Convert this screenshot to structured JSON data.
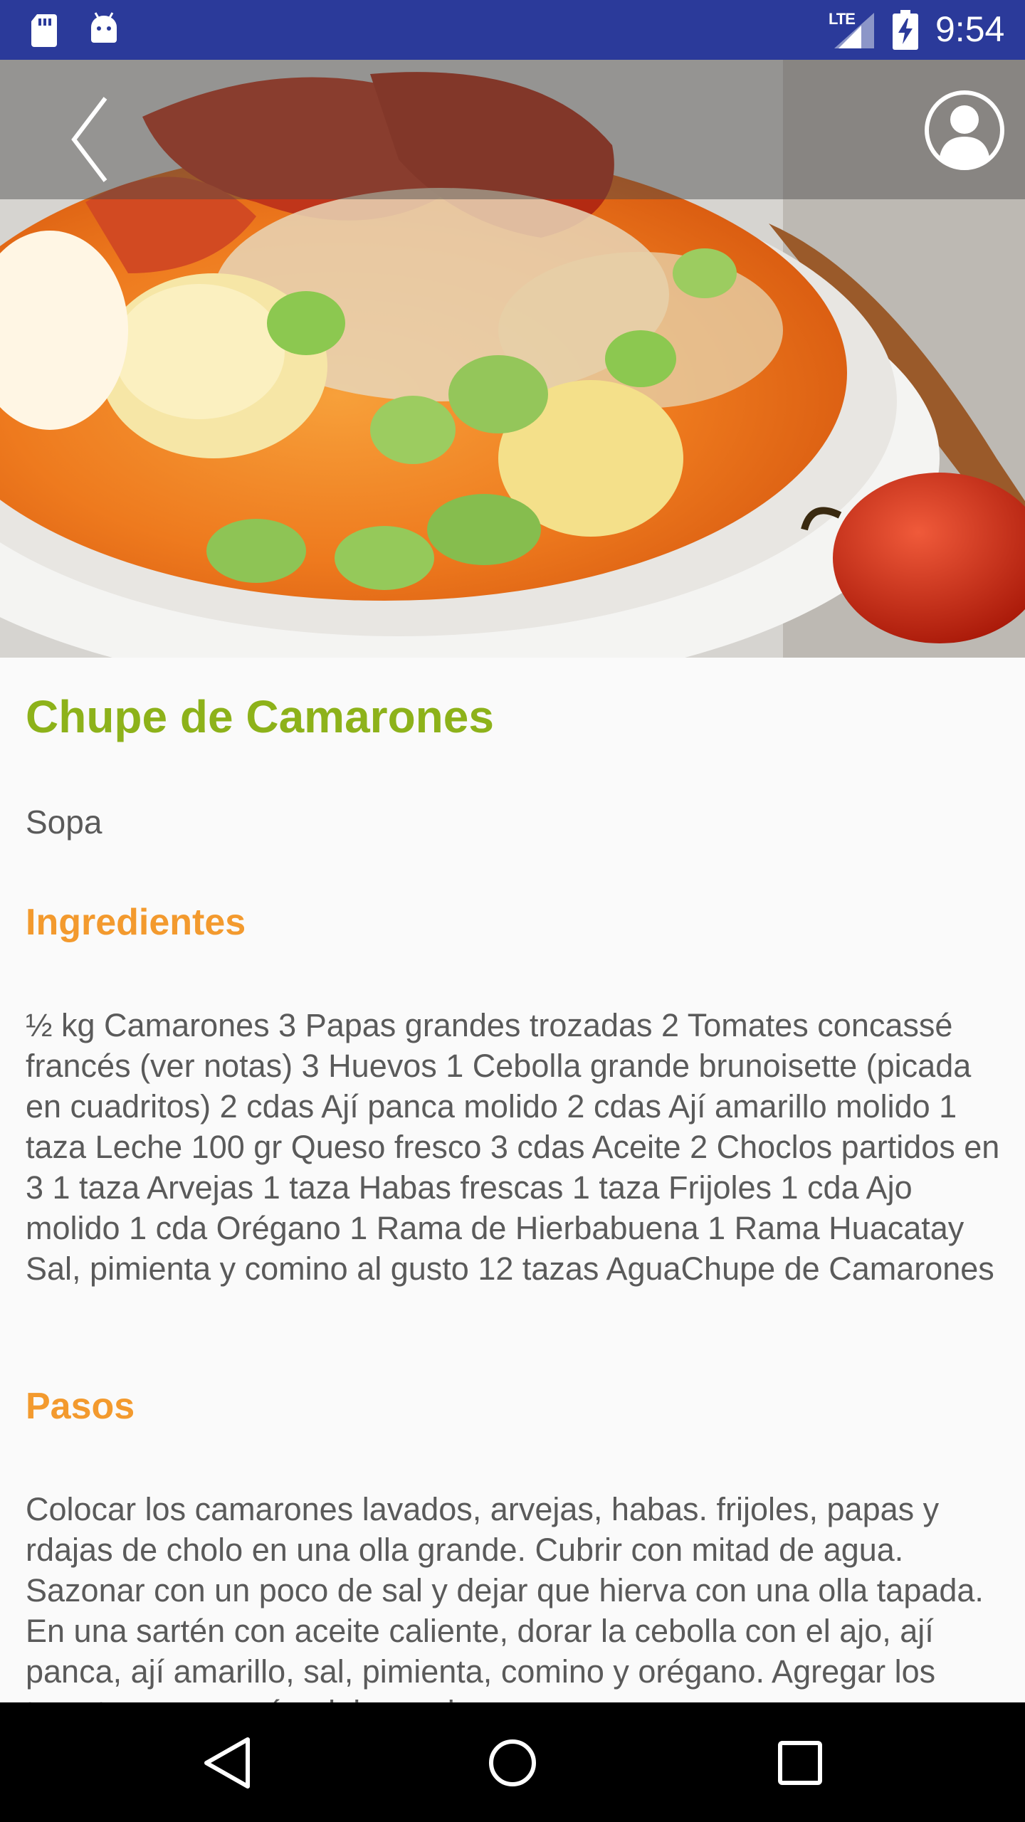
{
  "status_bar": {
    "network": "LTE",
    "time": "9:54",
    "icons": [
      "sd-card-icon",
      "android-icon",
      "signal-icon",
      "battery-charging-icon"
    ]
  },
  "toolbar": {
    "icons": [
      "back-arrow-icon",
      "profile-icon"
    ]
  },
  "hero_image": {
    "subject": "seafood-soup-photo"
  },
  "recipe": {
    "title": "Chupe de Camarones",
    "category": "Sopa",
    "ingredients_heading": "Ingredientes",
    "ingredients": "½ kg Camarones 3 Papas grandes trozadas 2 Tomates concassé francés (ver notas) 3 Huevos 1 Cebolla grande brunoisette (picada en cuadritos) 2 cdas Ají panca molido 2 cdas Ají amarillo molido 1 taza Leche 100 gr Queso fresco 3 cdas Aceite 2 Choclos partidos en 3 1 taza Arvejas 1 taza Habas frescas 1 taza Frijoles 1 cda Ajo molido 1 cda Orégano 1 Rama de Hierbabuena 1 Rama Huacatay Sal, pimienta y comino al gusto 12 tazas AguaChupe de Camarones",
    "steps_heading": "Pasos",
    "steps": "Colocar los camarones lavados, arvejas, habas. frijoles, papas y rdajas de cholo en una olla grande.  Cubrir con mitad de agua.  Sazonar con un poco de sal y dejar que hierva con una olla tapada.  En una sartén con aceite caliente, dorar la cebolla con el ajo, ají panca, ají amarillo, sal, pimienta, comino y orégano. Agregar los tomates concassé y dejar cocinar."
  },
  "nav_bar": {
    "icons": [
      "nav-back-icon",
      "nav-home-icon",
      "nav-recents-icon"
    ]
  },
  "colors": {
    "status_bar": "#2b3a9a",
    "title": "#8db21a",
    "section_heading": "#f39a2e",
    "body_text": "#5a5a5a",
    "content_bg": "#fafafa"
  }
}
